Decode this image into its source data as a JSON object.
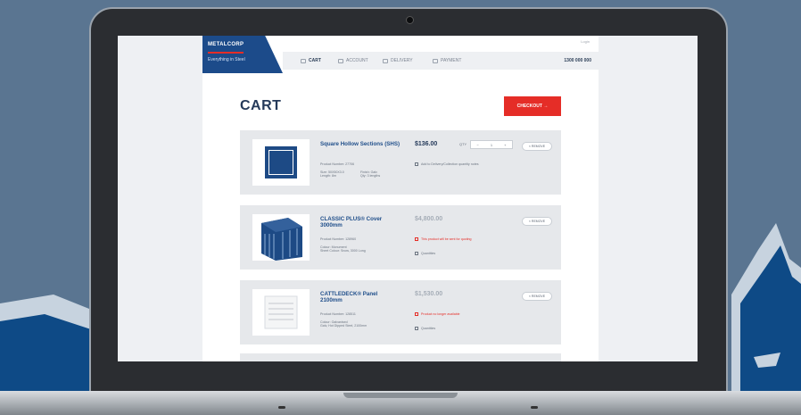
{
  "site": {
    "logo": {
      "name": "METALCORP",
      "tagline": "Everything in Steel"
    },
    "top_link": "Login",
    "nav": [
      {
        "label": "CART",
        "icon": "cart-icon",
        "active": true
      },
      {
        "label": "ACCOUNT",
        "icon": "account-icon",
        "active": false
      },
      {
        "label": "DELIVERY",
        "icon": "delivery-icon",
        "active": false
      },
      {
        "label": "PAYMENT",
        "icon": "payment-icon",
        "active": false
      }
    ],
    "phone": "1300 000 000"
  },
  "cart": {
    "title": "CART",
    "checkout_label": "CHECKOUT  →",
    "items": [
      {
        "name": "Square Hollow Sections (SHS)",
        "price": "$136.00",
        "qty_label": "QTY",
        "qty_value": "1",
        "remove_label": "× REMOVE",
        "product_number": "Product Number: 27706",
        "details_left": "Size: 50X50X3.0\nLength: 8m",
        "details_right": "Finish: Galv\nQty: 3 lengths",
        "note": "Add to Delivery/Collection quantity notes"
      },
      {
        "name": "CLASSIC PLUS® Cover 3000mm",
        "price": "$4,800.00",
        "remove_label": "× REMOVE",
        "product_number": "Product Number: 128960",
        "details_left": "Colour: Monument\nSheet Colour: Snow, 3000 Long",
        "note_red": "This product will be sent for quoting",
        "note": "Quantities"
      },
      {
        "name": "CATTLEDECK® Panel 2100mm",
        "price": "$1,530.00",
        "remove_label": "× REMOVE",
        "product_number": "Product Number: 128511",
        "details_left": "Colour: Galvanised\nGalv, Hot Dipped Steel, 2100mm",
        "note_red": "Product no longer available",
        "note": "Quantities"
      }
    ]
  }
}
